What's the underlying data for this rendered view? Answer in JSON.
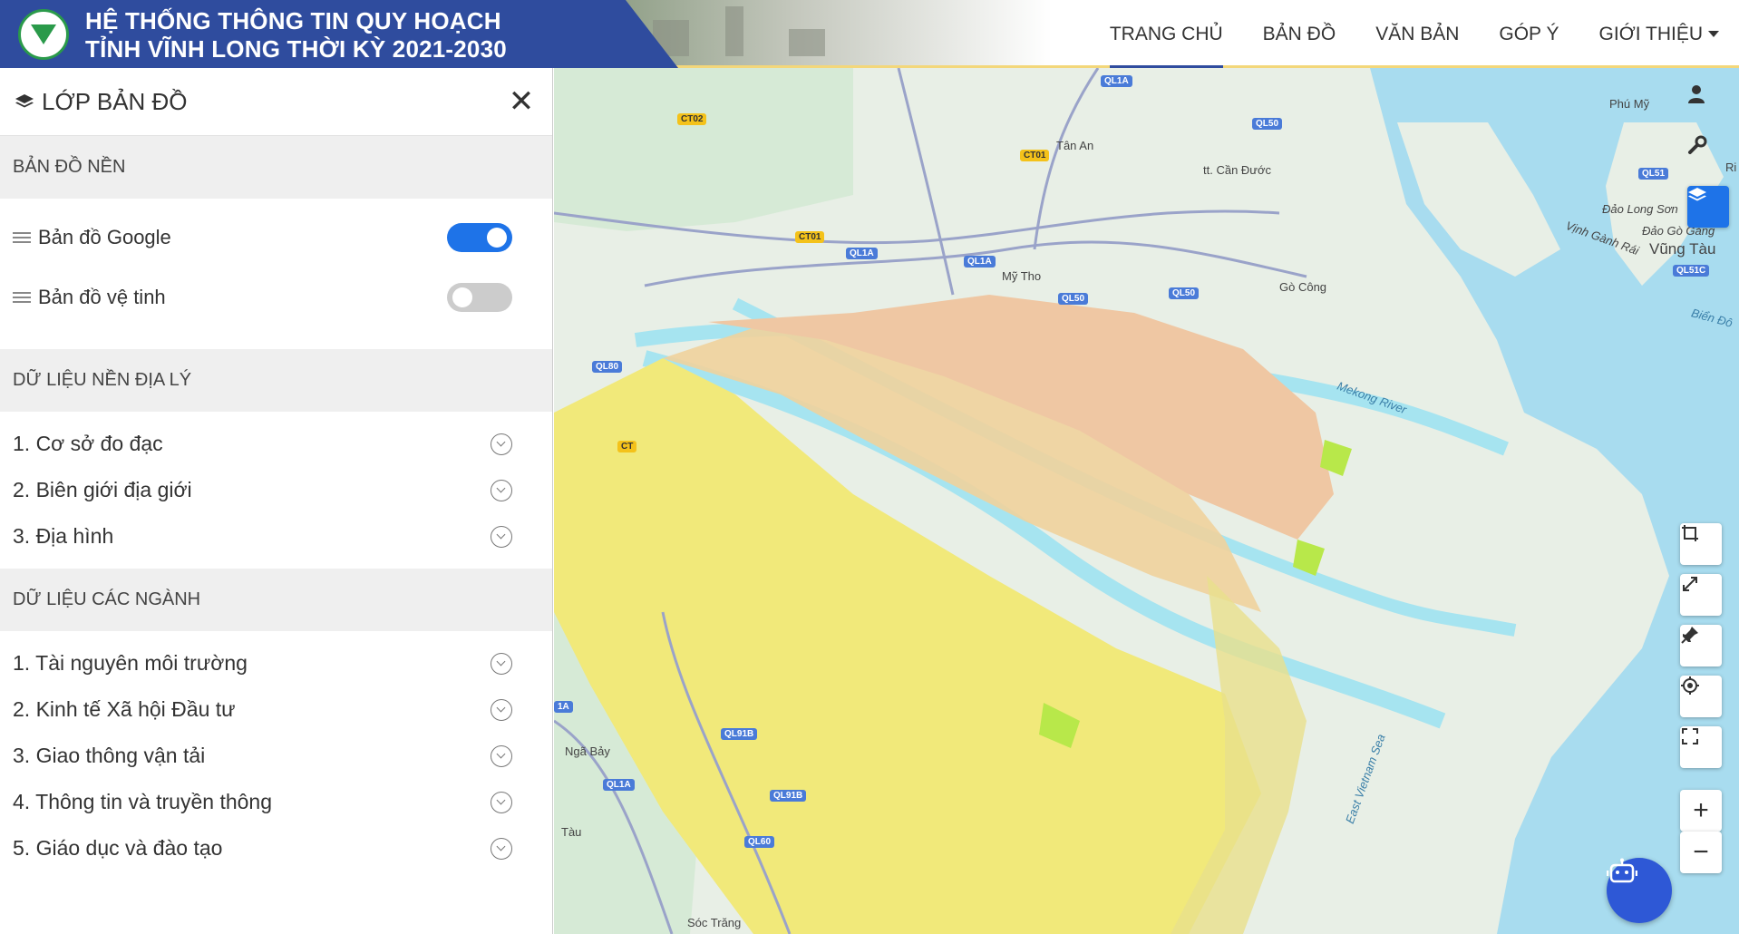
{
  "header": {
    "title_line1": "HỆ THỐNG THÔNG TIN QUY HOẠCH",
    "title_line2": "TỈNH VĨNH LONG THỜI KỲ 2021-2030",
    "nav": [
      {
        "label": "TRANG CHỦ",
        "active": true
      },
      {
        "label": "BẢN ĐỒ"
      },
      {
        "label": "VĂN BẢN"
      },
      {
        "label": "GÓP Ý"
      },
      {
        "label": "GIỚI THIỆU"
      }
    ]
  },
  "sidebar": {
    "title": "LỚP BẢN ĐỒ",
    "close_glyph": "✕",
    "basemap": {
      "header": "BẢN ĐỒ NỀN",
      "items": [
        {
          "label": "Bản đồ Google",
          "on": true
        },
        {
          "label": "Bản đồ vệ tinh",
          "on": false
        }
      ]
    },
    "geo": {
      "header": "DỮ LIỆU NỀN ĐỊA LÝ",
      "items": [
        "1. Cơ sở đo đạc",
        "2. Biên giới địa giới",
        "3. Địa hình"
      ]
    },
    "sector": {
      "header": "DỮ LIỆU CÁC NGÀNH",
      "items": [
        "1. Tài nguyên môi trường",
        "2. Kinh tế Xã hội Đầu tư",
        "3. Giao thông vận tải",
        "4. Thông tin và truyền thông",
        "5. Giáo dục và đào tạo"
      ]
    }
  },
  "map": {
    "labels": {
      "tan_an": "Tân An",
      "can_duoc": "tt. Cần Đước",
      "my_tho": "Mỹ Tho",
      "go_cong": "Gò Công",
      "phu_my": "Phú Mỹ",
      "long_son": "Đảo Long Sơn",
      "go_gang": "Đảo Gò Găng",
      "vung_tau": "Vũng Tàu",
      "vinh_ganh_rai": "Vịnh Gành Rái",
      "bien_dong": "Biển Đô",
      "nga_bay": "Ngã Bảy",
      "tau": "Tàu",
      "soc_trang": "Sóc Trăng",
      "east_sea": "East Vietnam Sea",
      "mekong": "Mekong River",
      "ri": "Ri"
    },
    "shields": [
      "QL1A",
      "QL50",
      "CT02",
      "CT01",
      "QL1A",
      "QL1A",
      "CT01",
      "QL50",
      "QL50",
      "QL51",
      "QL51C",
      "QL80",
      "CT",
      "QL91B",
      "QL1A",
      "QL91B",
      "QL60",
      "1A"
    ],
    "colors": {
      "water": "#a6e4f0",
      "land": "#e8efe6",
      "planning_yellow": "#f2e87a",
      "planning_orange": "#efc9a0",
      "accent": "#1e73e8",
      "brand": "#2f4c9e"
    }
  },
  "controls": {
    "right_top": [
      "user-icon",
      "wrench-icon",
      "layers-icon"
    ],
    "right_mid": [
      "crop-icon",
      "expand-icon",
      "pin-icon",
      "locate-icon",
      "fullscreen-icon"
    ],
    "zoom_in": "+",
    "zoom_out": "−"
  }
}
